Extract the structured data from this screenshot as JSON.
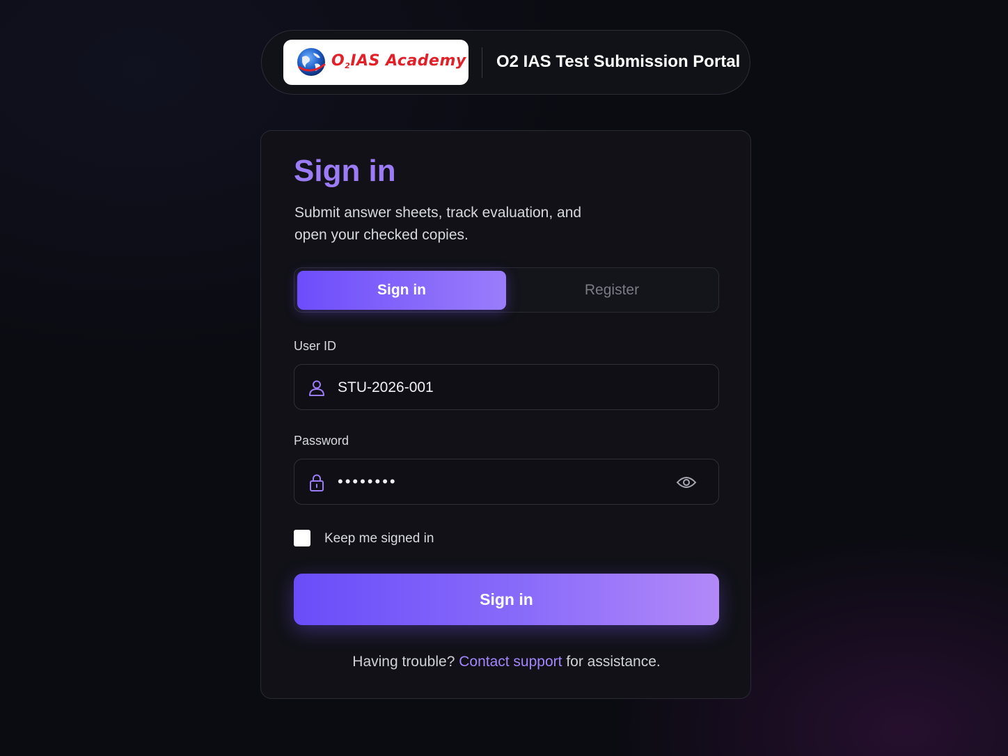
{
  "header": {
    "logo_text_main": "O",
    "logo_text_sub": "2",
    "logo_text_rest": "IAS Academy",
    "portal_title": "O2 IAS Test Submission Portal"
  },
  "card": {
    "title": "Sign in",
    "subtitle": "Submit answer sheets, track evaluation, and open your checked copies."
  },
  "tabs": [
    {
      "label": "Sign in",
      "active": true
    },
    {
      "label": "Register",
      "active": false
    }
  ],
  "form": {
    "user_id_label": "User ID",
    "user_id_value": "STU-2026-001",
    "password_label": "Password",
    "password_value": "••••••••",
    "keep_signed_in_label": "Keep me signed in",
    "keep_signed_in_checked": false,
    "submit_label": "Sign in"
  },
  "footer": {
    "prefix": "Having trouble? ",
    "link": "Contact support",
    "suffix": " for assistance."
  },
  "colors": {
    "accent": "#9b7cf6",
    "button_start": "#6a4df9",
    "button_end": "#b389f8",
    "logo_red": "#e2202a"
  },
  "icons": {
    "user": "user-icon",
    "lock": "lock-icon",
    "eye": "eye-icon",
    "globe": "globe-icon"
  }
}
